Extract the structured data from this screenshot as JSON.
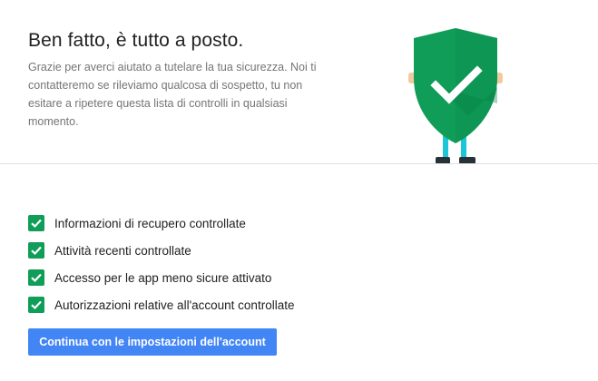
{
  "header": {
    "title": "Ben fatto, è tutto a posto.",
    "description": "Grazie per averci aiutato a tutelare la tua sicurezza. Noi ti contatteremo se rileviamo qualcosa di sospetto, tu non esitare a ripetere questa lista di controlli in qualsiasi momento."
  },
  "illustration": {
    "icon": "shield-checkmark-icon",
    "shield_color": "#0f9d58",
    "legs_color": "#1dc6d6"
  },
  "checklist": {
    "items": [
      {
        "label": "Informazioni di recupero controllate",
        "icon": "checkbox-checked-icon"
      },
      {
        "label": "Attività recenti controllate",
        "icon": "checkbox-checked-icon"
      },
      {
        "label": "Accesso per le app meno sicure attivato",
        "icon": "checkbox-checked-icon"
      },
      {
        "label": "Autorizzazioni relative all'account controllate",
        "icon": "checkbox-checked-icon"
      }
    ]
  },
  "actions": {
    "continue_label": "Continua con le impostazioni dell'account",
    "accent_color": "#4285f4"
  }
}
